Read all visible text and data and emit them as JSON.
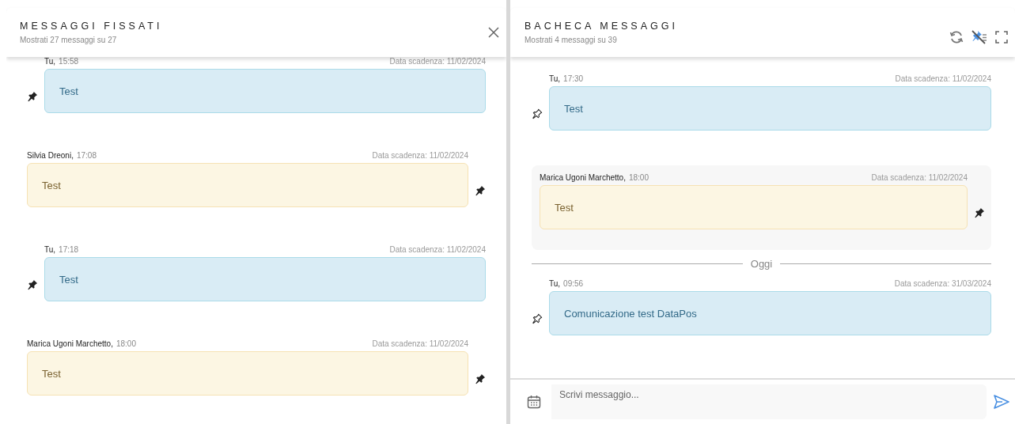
{
  "pinned_panel": {
    "title": "MESSAGGI FISSATI",
    "subtitle": "Mostrati 27 messaggi su 27",
    "messages": [
      {
        "own": true,
        "author": "Tu,",
        "time": "15:58",
        "expiry": "Data scadenza: 11/02/2024",
        "text": "Test",
        "pinned": true
      },
      {
        "own": false,
        "author": "Silvia Dreoni,",
        "time": "17:08",
        "expiry": "Data scadenza: 11/02/2024",
        "text": "Test",
        "pinned": true
      },
      {
        "own": true,
        "author": "Tu,",
        "time": "17:18",
        "expiry": "Data scadenza: 11/02/2024",
        "text": "Test",
        "pinned": true
      },
      {
        "own": false,
        "author": "Marica Ugoni Marchetto,",
        "time": "18:00",
        "expiry": "Data scadenza: 11/02/2024",
        "text": "Test",
        "pinned": true
      }
    ]
  },
  "board_panel": {
    "title": "BACHECA MESSAGGI",
    "subtitle": "Mostrati 4 messaggi su 39",
    "pin_filter_on": true,
    "items": [
      {
        "kind": "message",
        "own": true,
        "author": "Tu,",
        "time": "17:30",
        "expiry": "Data scadenza: 11/02/2024",
        "text": "Test",
        "pinned": false,
        "highlighted": false
      },
      {
        "kind": "message",
        "own": false,
        "author": "Marica Ugoni Marchetto,",
        "time": "18:00",
        "expiry": "Data scadenza: 11/02/2024",
        "text": "Test",
        "pinned": true,
        "highlighted": true
      },
      {
        "kind": "divider",
        "label": "Oggi"
      },
      {
        "kind": "message",
        "own": true,
        "author": "Tu,",
        "time": "09:56",
        "expiry": "Data scadenza: 31/03/2024",
        "text": "Comunicazione test DataPos",
        "pinned": false,
        "highlighted": false
      }
    ]
  },
  "composer": {
    "placeholder": "Scrivi messaggio..."
  }
}
